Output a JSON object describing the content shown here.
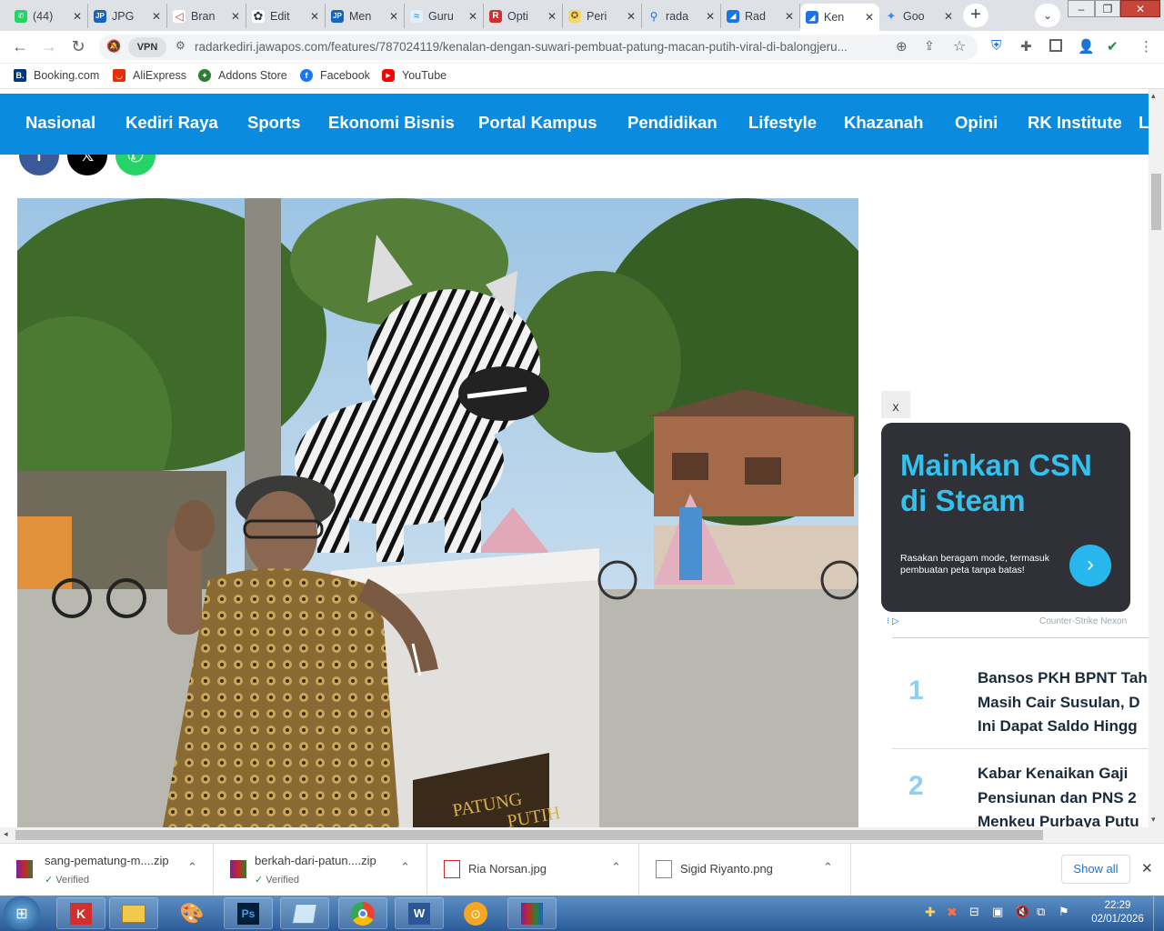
{
  "tabs": [
    {
      "label": "(44)",
      "icon": "whatsapp-icon",
      "color": "#25d366"
    },
    {
      "label": "JPG",
      "icon": "jp-icon",
      "color": "#1565c0"
    },
    {
      "label": "Bran",
      "icon": "bran-icon",
      "color": "#c62828"
    },
    {
      "label": "Edit",
      "icon": "openai-icon",
      "color": "#333333"
    },
    {
      "label": "Men",
      "icon": "jp-icon",
      "color": "#1565c0"
    },
    {
      "label": "Guru",
      "icon": "guru-icon",
      "color": "#5c9bd1"
    },
    {
      "label": "Opti",
      "icon": "r-icon",
      "color": "#d32f2f"
    },
    {
      "label": "Peri",
      "icon": "emblem-icon",
      "color": "#b8860b"
    },
    {
      "label": "rada",
      "icon": "search-icon",
      "color": "#1a73e8"
    },
    {
      "label": "Rad",
      "icon": "radar-icon",
      "color": "#1a73e8"
    },
    {
      "label": "Ken",
      "icon": "radar-icon",
      "color": "#1a73e8",
      "active": true
    },
    {
      "label": "Goo",
      "icon": "gemini-icon",
      "color": "#4285f4"
    }
  ],
  "address": {
    "url": "radarkediri.jawapos.com/features/787024119/kenalan-dengan-suwari-pembuat-patung-macan-putih-viral-di-balongjeru...",
    "vpn_label": "VPN"
  },
  "bookmarks": [
    {
      "label": "Booking.com",
      "icon": "booking-icon",
      "color": "#003580"
    },
    {
      "label": "AliExpress",
      "icon": "aliexpress-icon",
      "color": "#e62e04"
    },
    {
      "label": "Addons Store",
      "icon": "addons-icon",
      "color": "#2e7d32"
    },
    {
      "label": "Facebook",
      "icon": "facebook-icon",
      "color": "#1877f2"
    },
    {
      "label": "YouTube",
      "icon": "youtube-icon",
      "color": "#ff0000"
    }
  ],
  "site_nav": [
    "Nasional",
    "Kediri Raya",
    "Sports",
    "Ekonomi Bisnis",
    "Portal Kampus",
    "Pendidikan",
    "Lifestyle",
    "Khazanah",
    "Opini",
    "RK Institute",
    "Le"
  ],
  "photo": {
    "plaque_line1": "PATUNG",
    "plaque_line2": "PUTIH"
  },
  "ad": {
    "close": "x",
    "headline_1": "Mainkan CSN",
    "headline_2": "di Steam",
    "subtext": "Rasakan beragam mode, termasuk pembuatan peta tanpa batas!",
    "footer": "Counter-Strike Nexon"
  },
  "popular": [
    {
      "rank": "1",
      "lines": [
        "Bansos PKH BPNT Tah",
        "Masih Cair Susulan, D",
        "Ini Dapat Saldo Hingg"
      ]
    },
    {
      "rank": "2",
      "lines": [
        "Kabar Kenaikan Gaji",
        "Pensiunan dan PNS 2",
        "Menkeu Purbaya Putu"
      ]
    }
  ],
  "downloads": [
    {
      "name": "sang-pematung-m....zip",
      "status": "Verified"
    },
    {
      "name": "berkah-dari-patun....zip",
      "status": "Verified"
    },
    {
      "name": "Ria Norsan.jpg",
      "status": ""
    },
    {
      "name": "Sigid Riyanto.png",
      "status": ""
    }
  ],
  "show_all": "Show all",
  "clock": {
    "time": "22:29",
    "date": "02/01/2026"
  },
  "accent_color": "#0b8be0"
}
